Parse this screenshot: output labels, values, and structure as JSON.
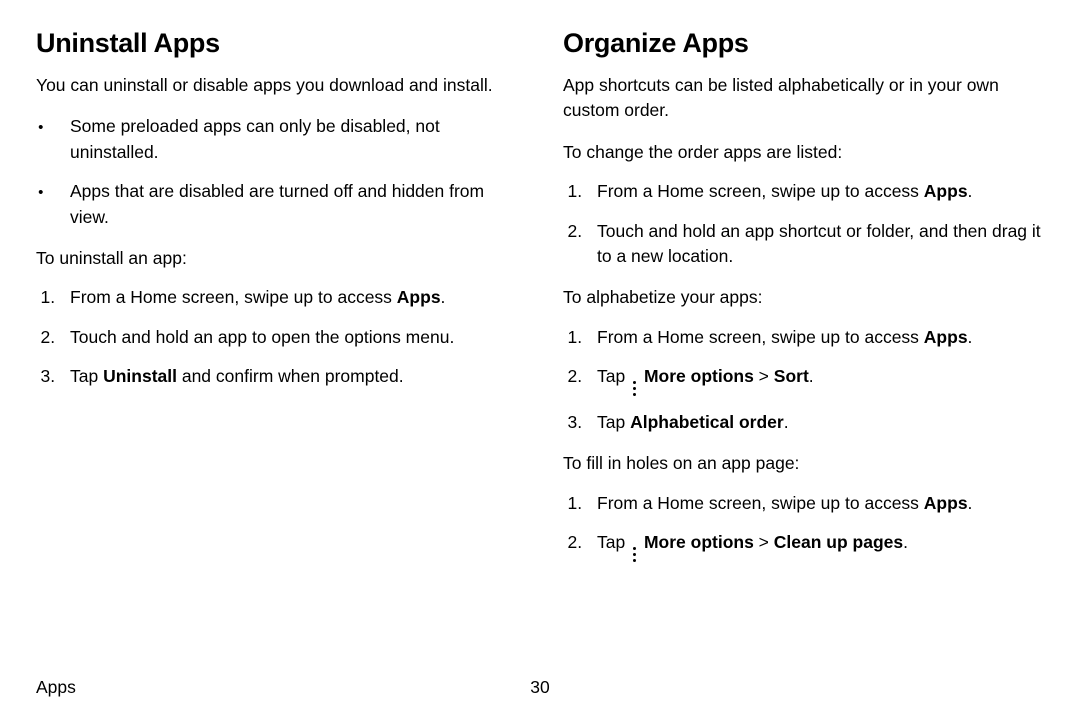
{
  "left": {
    "heading": "Uninstall Apps",
    "intro": "You can uninstall or disable apps you download and install.",
    "bullets": [
      "Some preloaded apps can only be disabled, not uninstalled.",
      "Apps that are disabled are turned off and hidden from view."
    ],
    "sub1": "To uninstall an app:",
    "steps1": {
      "s1a": "From a Home screen, swipe up to access ",
      "s1b": "Apps",
      "s1c": ".",
      "s2": "Touch and hold an app to open the options menu.",
      "s3a": "Tap ",
      "s3b": "Uninstall",
      "s3c": " and confirm when prompted."
    }
  },
  "right": {
    "heading": "Organize Apps",
    "intro": "App shortcuts can be listed alphabetically or in your own custom order.",
    "sub1": "To change the order apps are listed:",
    "steps1": {
      "s1a": "From a Home screen, swipe up to access ",
      "s1b": "Apps",
      "s1c": ".",
      "s2": "Touch and hold an app shortcut or folder, and then drag it to a new location."
    },
    "sub2": "To alphabetize your apps:",
    "steps2": {
      "s1a": "From a Home screen, swipe up to access ",
      "s1b": "Apps",
      "s1c": ".",
      "s2a": "Tap ",
      "s2b": "More options",
      "s2c": " > ",
      "s2d": "Sort",
      "s2e": ".",
      "s3a": "Tap ",
      "s3b": "Alphabetical order",
      "s3c": "."
    },
    "sub3": "To fill in holes on an app page:",
    "steps3": {
      "s1a": "From a Home screen, swipe up to access ",
      "s1b": "Apps",
      "s1c": ".",
      "s2a": "Tap ",
      "s2b": "More options",
      "s2c": " > ",
      "s2d": "Clean up pages",
      "s2e": "."
    }
  },
  "footer": {
    "section": "Apps",
    "page": "30"
  }
}
